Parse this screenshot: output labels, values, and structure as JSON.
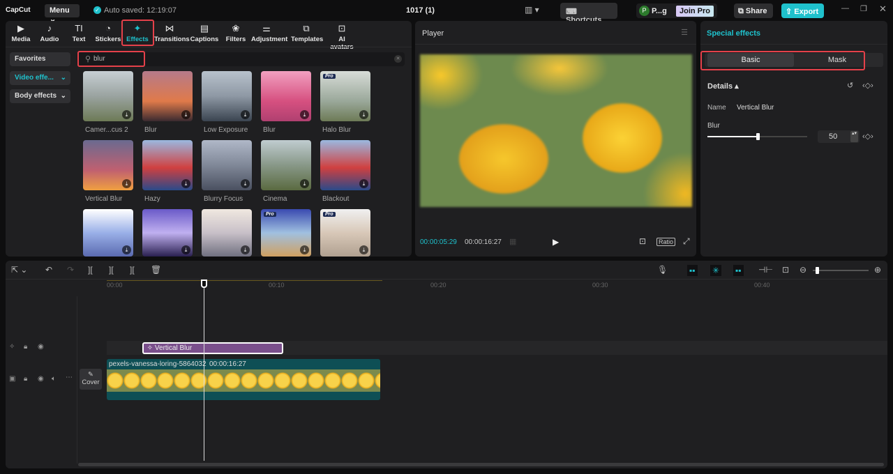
{
  "app": {
    "logo": "CapCut",
    "menu": "Menu",
    "autosave": "Auto saved: 12:19:07",
    "project_title": "1017 (1)",
    "shortcuts": "Shortcuts",
    "user_initial": "P",
    "user_name": "P...g",
    "join_pro": "Join Pro",
    "share": "Share",
    "export": "Export",
    "accent": "#1fc1cc"
  },
  "toolbar": [
    {
      "label": "Media",
      "icon": "media-icon",
      "glyph": "▶"
    },
    {
      "label": "Audio",
      "icon": "audio-icon",
      "glyph": "♪"
    },
    {
      "label": "Text",
      "icon": "text-icon",
      "glyph": "TI"
    },
    {
      "label": "Stickers",
      "icon": "sticker-icon",
      "glyph": "◔"
    },
    {
      "label": "Effects",
      "icon": "effects-icon",
      "glyph": "✦"
    },
    {
      "label": "Transitions",
      "icon": "transitions-icon",
      "glyph": "⋈"
    },
    {
      "label": "Captions",
      "icon": "captions-icon",
      "glyph": "▤"
    },
    {
      "label": "Filters",
      "icon": "filters-icon",
      "glyph": "❀"
    },
    {
      "label": "Adjustment",
      "icon": "adjustment-icon",
      "glyph": "⚌"
    },
    {
      "label": "Templates",
      "icon": "templates-icon",
      "glyph": "⧉"
    },
    {
      "label": "AI avatars",
      "icon": "ai-avatars-icon",
      "glyph": "⊡"
    }
  ],
  "sidebar": {
    "favorites": "Favorites",
    "video_effects": "Video effe...",
    "body_effects": "Body effects"
  },
  "search": {
    "value": "blur"
  },
  "effects": [
    {
      "name": "Camer...cus 2",
      "pro": false
    },
    {
      "name": "Blur",
      "pro": false
    },
    {
      "name": "Low Exposure",
      "pro": false
    },
    {
      "name": "Blur",
      "pro": false
    },
    {
      "name": "Halo Blur",
      "pro": true
    },
    {
      "name": "Vertical Blur",
      "pro": false
    },
    {
      "name": "Hazy",
      "pro": false
    },
    {
      "name": "Blurry Focus",
      "pro": false
    },
    {
      "name": "Cinema",
      "pro": false
    },
    {
      "name": "Blackout",
      "pro": false
    },
    {
      "name": "",
      "pro": false
    },
    {
      "name": "",
      "pro": false
    },
    {
      "name": "",
      "pro": false
    },
    {
      "name": "",
      "pro": true
    },
    {
      "name": "",
      "pro": true
    }
  ],
  "pro_badge": "Pro",
  "player": {
    "title": "Player",
    "current_time": "00:00:05:29",
    "total_time": "00:00:16:27",
    "ratio": "Ratio"
  },
  "right_panel": {
    "title": "Special effects",
    "tabs": [
      "Basic",
      "Mask"
    ],
    "details": "Details",
    "name_label": "Name",
    "name_value": "Vertical Blur",
    "blur_label": "Blur",
    "blur_value": "50",
    "blur_fraction": 0.5
  },
  "timeline": {
    "ticks": [
      "00:00",
      "00:10",
      "00:20",
      "00:30",
      "00:40"
    ],
    "playhead_seconds": 5.9,
    "effect_clip": {
      "label": "Vertical Blur",
      "start": 2.1,
      "end": 10.8
    },
    "video_clip": {
      "name": "pexels-vanessa-loring-5864032",
      "duration": "00:00:16:27",
      "start": 0,
      "end": 16.9
    },
    "cover": "Cover",
    "zoom_fraction": 0.05
  }
}
